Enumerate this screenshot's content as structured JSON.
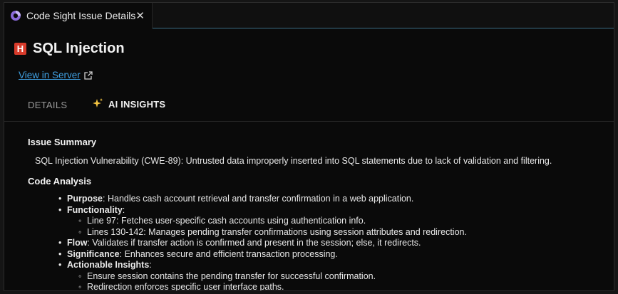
{
  "tab": {
    "title": "Code Sight Issue Details",
    "close_glyph": "✕",
    "icon": "code-sight-logo-icon"
  },
  "issue": {
    "severity_letter": "H",
    "severity_color": "#d83b2b",
    "title": "SQL Injection"
  },
  "view_link": {
    "label": "View in Server",
    "icon": "external-link-icon"
  },
  "subtabs": {
    "details": "DETAILS",
    "ai_insights": "AI INSIGHTS",
    "active": "AI INSIGHTS"
  },
  "summary": {
    "heading": "Issue Summary",
    "text": "SQL Injection Vulnerability (CWE-89): Untrusted data improperly inserted into SQL statements due to lack of validation and filtering."
  },
  "analysis": {
    "heading": "Code Analysis",
    "purpose": {
      "label": "Purpose",
      "text": ": Handles cash account retrieval and transfer confirmation in a web application."
    },
    "functionality": {
      "label": "Functionality",
      "suffix": ":",
      "items": [
        "Line 97: Fetches user-specific cash accounts using authentication info.",
        "Lines 130-142: Manages pending transfer confirmations using session attributes and redirection."
      ]
    },
    "flow": {
      "label": "Flow",
      "text": ": Validates if transfer action is confirmed and present in the session; else, it redirects."
    },
    "significance": {
      "label": "Significance",
      "text": ": Enhances secure and efficient transaction processing."
    },
    "actionable": {
      "label": "Actionable Insights",
      "suffix": ":",
      "items": [
        "Ensure session contains the pending transfer for successful confirmation.",
        "Redirection enforces specific user interface paths."
      ]
    }
  },
  "colors": {
    "background": "#0a0a0a",
    "link": "#3f9fe0",
    "accent_underline": "#3c6f86",
    "sparkle": "#f5c542"
  }
}
